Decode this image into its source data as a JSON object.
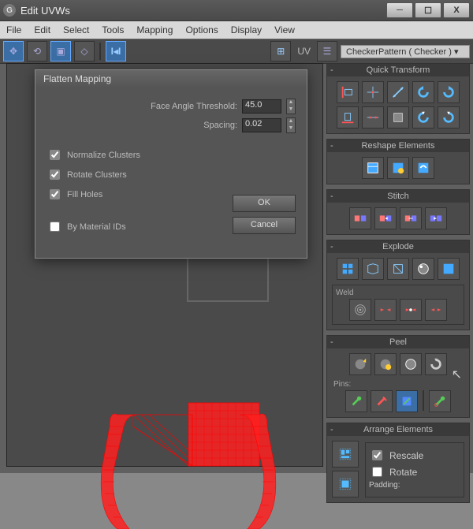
{
  "window": {
    "title": "Edit UVWs"
  },
  "menu": [
    "File",
    "Edit",
    "Select",
    "Tools",
    "Mapping",
    "Options",
    "Display",
    "View"
  ],
  "toolbar": {
    "uv_label": "UV",
    "texture": "CheckerPattern  ( Checker )"
  },
  "dialog": {
    "title": "Flatten Mapping",
    "face_angle_label": "Face Angle Threshold:",
    "face_angle_value": "45.0",
    "spacing_label": "Spacing:",
    "spacing_value": "0.02",
    "normalize": "Normalize Clusters",
    "rotate": "Rotate Clusters",
    "fill": "Fill Holes",
    "bymat": "By Material IDs",
    "ok": "OK",
    "cancel": "Cancel"
  },
  "rollouts": {
    "quick": "Quick Transform",
    "reshape": "Reshape Elements",
    "stitch": "Stitch",
    "explode": "Explode",
    "weld": "Weld",
    "peel": "Peel",
    "pins": "Pins:",
    "arrange": "Arrange Elements",
    "rescale": "Rescale",
    "rotate": "Rotate",
    "padding": "Padding:"
  }
}
